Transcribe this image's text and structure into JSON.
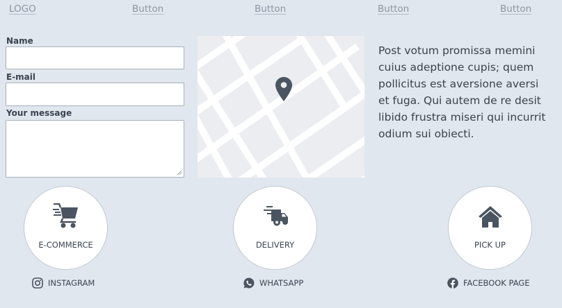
{
  "nav": {
    "logo": "LOGO",
    "buttons": [
      "Button",
      "Button",
      "Button",
      "Button"
    ]
  },
  "form": {
    "name_label": "Name",
    "email_label": "E-mail",
    "message_label": "Your message"
  },
  "map": {
    "marker_icon": "map-pin-icon"
  },
  "paragraph": "Post votum promissa memini cuius adeptione cupis; quem pollicitus est aversione aversi et fuga. Qui autem de re desit libido frustra miseri qui incurrit odium sui obiecti.",
  "services": [
    {
      "label": "E-COMMERCE",
      "icon": "shopping-cart-icon"
    },
    {
      "label": "DELIVERY",
      "icon": "delivery-truck-icon"
    },
    {
      "label": "PICK UP",
      "icon": "house-icon"
    }
  ],
  "socials": [
    {
      "label": "INSTAGRAM",
      "icon": "instagram-icon"
    },
    {
      "label": "WHATSAPP",
      "icon": "whatsapp-icon"
    },
    {
      "label": "FACEBOOK PAGE",
      "icon": "facebook-icon"
    }
  ],
  "colors": {
    "background": "#e1e7ef",
    "icon": "#4a5561",
    "text": "#39424c",
    "nav_text": "#8c96a2"
  }
}
